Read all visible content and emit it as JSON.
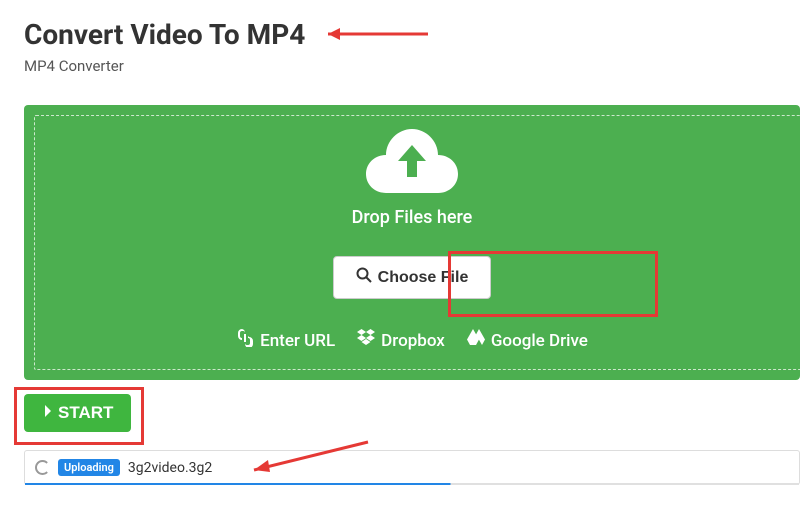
{
  "header": {
    "title": "Convert Video To MP4",
    "subtitle": "MP4 Converter"
  },
  "dropzone": {
    "drop_text": "Drop Files here",
    "choose_button": "Choose File",
    "links": {
      "enter_url": "Enter URL",
      "dropbox": "Dropbox",
      "google_drive": "Google Drive"
    }
  },
  "start_button": "START",
  "queue": {
    "status_label": "Uploading",
    "filename": "3g2video.3g2"
  }
}
